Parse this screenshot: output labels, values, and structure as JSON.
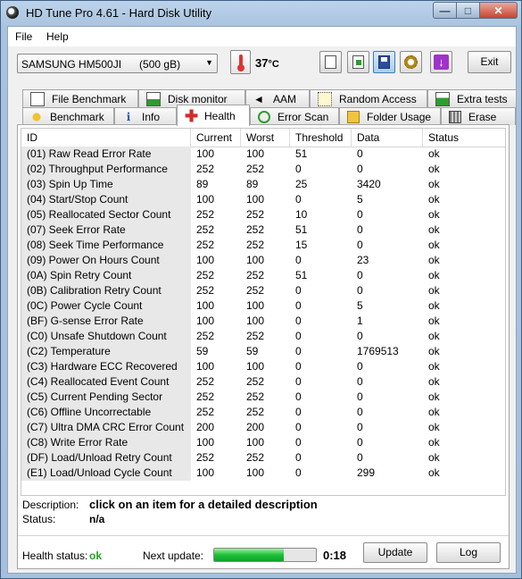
{
  "window": {
    "title": "HD Tune Pro 4.61 - Hard Disk Utility"
  },
  "menu": {
    "file": "File",
    "help": "Help"
  },
  "toolbar": {
    "drive": "SAMSUNG HM500JI",
    "drive_size": "(500 gB)",
    "temperature": "37",
    "temperature_unit": "°C",
    "exit_label": "Exit",
    "icons": [
      "copy-text-icon",
      "copy-screenshot-icon",
      "save-icon",
      "options-gear-icon",
      "download-icon"
    ]
  },
  "tabs_top": [
    "File Benchmark",
    "Disk monitor",
    "AAM",
    "Random Access",
    "Extra tests"
  ],
  "tabs_bottom": [
    "Benchmark",
    "Info",
    "Health",
    "Error Scan",
    "Folder Usage",
    "Erase"
  ],
  "selected_tab": "Health",
  "table": {
    "columns": [
      "ID",
      "Current",
      "Worst",
      "Threshold",
      "Data",
      "Status"
    ],
    "rows": [
      [
        "(01) Raw Read Error Rate",
        "100",
        "100",
        "51",
        "0",
        "ok"
      ],
      [
        "(02) Throughput Performance",
        "252",
        "252",
        "0",
        "0",
        "ok"
      ],
      [
        "(03) Spin Up Time",
        "89",
        "89",
        "25",
        "3420",
        "ok"
      ],
      [
        "(04) Start/Stop Count",
        "100",
        "100",
        "0",
        "5",
        "ok"
      ],
      [
        "(05) Reallocated Sector Count",
        "252",
        "252",
        "10",
        "0",
        "ok"
      ],
      [
        "(07) Seek Error Rate",
        "252",
        "252",
        "51",
        "0",
        "ok"
      ],
      [
        "(08) Seek Time Performance",
        "252",
        "252",
        "15",
        "0",
        "ok"
      ],
      [
        "(09) Power On Hours Count",
        "100",
        "100",
        "0",
        "23",
        "ok"
      ],
      [
        "(0A) Spin Retry Count",
        "252",
        "252",
        "51",
        "0",
        "ok"
      ],
      [
        "(0B) Calibration Retry Count",
        "252",
        "252",
        "0",
        "0",
        "ok"
      ],
      [
        "(0C) Power Cycle Count",
        "100",
        "100",
        "0",
        "5",
        "ok"
      ],
      [
        "(BF) G-sense Error Rate",
        "100",
        "100",
        "0",
        "1",
        "ok"
      ],
      [
        "(C0) Unsafe Shutdown Count",
        "252",
        "252",
        "0",
        "0",
        "ok"
      ],
      [
        "(C2) Temperature",
        "59",
        "59",
        "0",
        "1769513",
        "ok"
      ],
      [
        "(C3) Hardware ECC Recovered",
        "100",
        "100",
        "0",
        "0",
        "ok"
      ],
      [
        "(C4) Reallocated Event Count",
        "252",
        "252",
        "0",
        "0",
        "ok"
      ],
      [
        "(C5) Current Pending Sector",
        "252",
        "252",
        "0",
        "0",
        "ok"
      ],
      [
        "(C6) Offline Uncorrectable",
        "252",
        "252",
        "0",
        "0",
        "ok"
      ],
      [
        "(C7) Ultra DMA CRC Error Count",
        "200",
        "200",
        "0",
        "0",
        "ok"
      ],
      [
        "(C8) Write Error Rate",
        "100",
        "100",
        "0",
        "0",
        "ok"
      ],
      [
        "(DF) Load/Unload Retry Count",
        "252",
        "252",
        "0",
        "0",
        "ok"
      ],
      [
        "(E1) Load/Unload Cycle Count",
        "100",
        "100",
        "0",
        "299",
        "ok"
      ]
    ]
  },
  "description": {
    "label": "Description:",
    "value": "click on an item for a detailed description",
    "status_label": "Status:",
    "status_value": "n/a"
  },
  "footer": {
    "health_label": "Health status:",
    "health_value": "ok",
    "next_update_label": "Next update:",
    "progress": 0.68,
    "countdown": "0:18",
    "update_label": "Update",
    "log_label": "Log"
  },
  "colors": {
    "ok": "#22a322",
    "progress": "#1fbf3b",
    "health_tab_icon": "#d42a2a"
  }
}
